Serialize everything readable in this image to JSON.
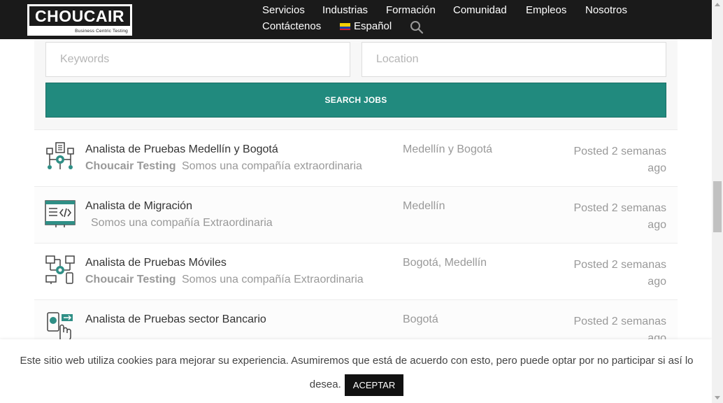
{
  "header": {
    "logo_text": "CHOUCAIR",
    "logo_tagline": "Business Centric Testing",
    "nav": [
      {
        "label": "Servicios"
      },
      {
        "label": "Industrias"
      },
      {
        "label": "Formación"
      },
      {
        "label": "Comunidad"
      },
      {
        "label": "Empleos"
      },
      {
        "label": "Nosotros"
      },
      {
        "label": "Contáctenos"
      }
    ],
    "language": "Español",
    "search_icon": "search-icon"
  },
  "search_form": {
    "keywords_placeholder": "Keywords",
    "location_placeholder": "Location",
    "button_label": "SEARCH JOBS",
    "button_color": "#218a7e"
  },
  "jobs": [
    {
      "title": "Analista de Pruebas Medellín y Bogotá",
      "company": "Choucair Testing",
      "tagline": "Somos una compañía extraordinaria",
      "location": "Medellín y Bogotá",
      "posted": "Posted 2 semanas ago",
      "icon": "network-process-icon"
    },
    {
      "title": "Analista de Migración",
      "company": "",
      "tagline": "Somos una compañía Extraordinaria",
      "location": "Medellín",
      "posted": "Posted 2 semanas ago",
      "icon": "code-screen-icon"
    },
    {
      "title": "Analista de Pruebas Móviles",
      "company": "Choucair Testing",
      "tagline": "Somos una compañía Extraordinaria",
      "location": "Bogotá, Medellín",
      "posted": "Posted 2 semanas ago",
      "icon": "mobile-devices-icon"
    },
    {
      "title": "Analista de Pruebas sector Bancario",
      "company": "",
      "tagline": "",
      "location": "Bogotá",
      "posted": "Posted 2 semanas ago",
      "icon": "banking-touch-icon"
    }
  ],
  "cookie_banner": {
    "text": "Este sitio web utiliza cookies para mejorar su experiencia. Asumiremos que está de acuerdo con esto, pero puede optar por no participar si así lo desea.",
    "accept_label": "ACEPTAR"
  },
  "colors": {
    "header_bg": "#1a1a1a",
    "accent": "#218a7e",
    "icon_teal": "#2f8f86"
  }
}
